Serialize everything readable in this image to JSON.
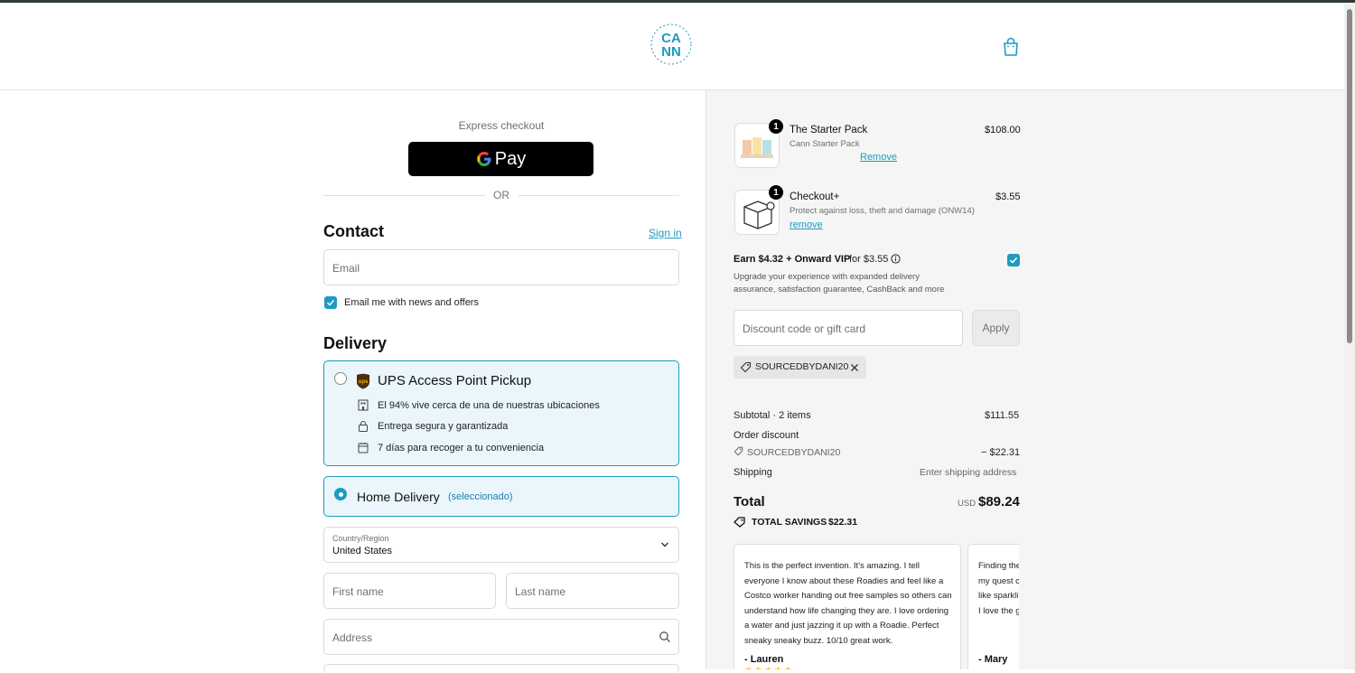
{
  "brand": {
    "logo_text": "CANN",
    "logo_ring_text": "ALL-NATURAL SOCIAL TONIC",
    "accent": "#1c9cc0"
  },
  "header": {
    "cart_icon": "shopping-bag-icon"
  },
  "express": {
    "label": "Express checkout",
    "gpay_label": "Pay",
    "or_label": "OR"
  },
  "contact": {
    "title": "Contact",
    "sign_in": "Sign in",
    "email_placeholder": "Email",
    "newsletter_label": "Email me with news and offers",
    "newsletter_checked": true
  },
  "delivery": {
    "title": "Delivery",
    "ups": {
      "title": "UPS Access Point Pickup",
      "features": [
        {
          "icon": "building-icon",
          "text": "El 94% vive cerca de una de nuestras ubicaciones"
        },
        {
          "icon": "lock-icon",
          "text": "Entrega segura y garantizada"
        },
        {
          "icon": "calendar-icon",
          "text": "7 días para recoger a tu conveniencia"
        }
      ]
    },
    "home": {
      "title": "Home Delivery",
      "selected_note": "(seleccionado)"
    },
    "country_label": "Country/Region",
    "country_value": "United States",
    "first_name_placeholder": "First name",
    "last_name_placeholder": "Last name",
    "address_placeholder": "Address"
  },
  "cart": {
    "items": [
      {
        "qty": "1",
        "name": "The Starter Pack",
        "variant": "Cann Starter Pack",
        "action": "Remove",
        "price": "$108.00"
      },
      {
        "qty": "1",
        "name": "Checkout+",
        "variant": "Protect against loss, theft and damage (ONW14)",
        "action": "remove",
        "price": "$3.55"
      }
    ],
    "onward": {
      "title": "Earn $4.32 + Onward VIP",
      "price_note": "for $3.55",
      "desc_line1": "Upgrade your experience with expanded delivery",
      "desc_line2": "assurance, satisfaction guarantee, CashBack and more",
      "checked": true
    },
    "discount_placeholder": "Discount code or gift card",
    "apply_label": "Apply",
    "applied_code": "SOURCEDBYDANI20"
  },
  "summary": {
    "subtotal_label": "Subtotal · 2 items",
    "subtotal_value": "$111.55",
    "order_discount_label": "Order discount",
    "discount_code": "SOURCEDBYDANI20",
    "discount_value": "− $22.31",
    "shipping_label": "Shipping",
    "shipping_value": "Enter shipping address",
    "total_label": "Total",
    "currency": "USD",
    "total_value": "$89.24",
    "savings_label": "TOTAL SAVINGS",
    "savings_value": "$22.31"
  },
  "reviews": [
    {
      "lines": [
        "This is the perfect invention. It's amazing. I tell",
        "everyone I know about these Roadies and feel like a",
        "Costco worker handing out free samples so others can",
        "understand how life changing they are. I love ordering",
        "a water and just jazzing it up with a Roadie. Perfect",
        "sneaky sneaky buzz. 10/10 great work."
      ],
      "author": "- Lauren"
    },
    {
      "lines": [
        "Finding the",
        "my quest c",
        "like sparkli",
        "I love the g"
      ],
      "author": "- Mary"
    }
  ]
}
